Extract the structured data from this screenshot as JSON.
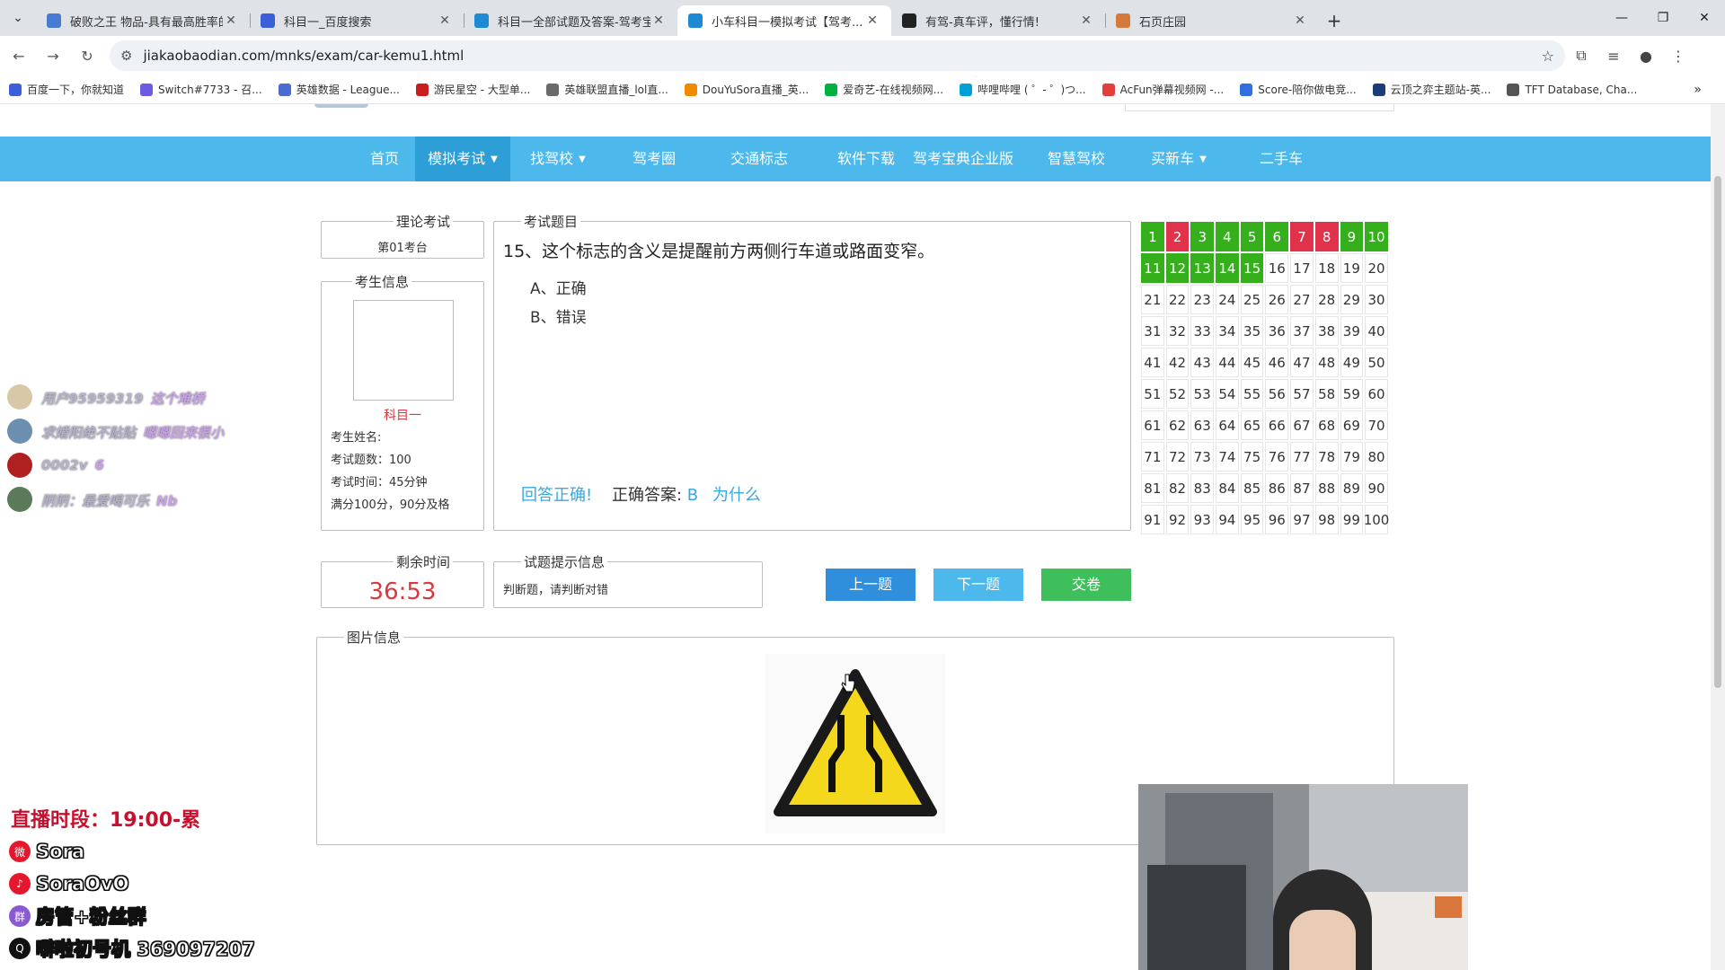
{
  "browser": {
    "tabs": [
      {
        "title": "破败之王 物品-具有最高胜率的...",
        "color": "#4a7bd4",
        "active": false
      },
      {
        "title": "科目一_百度搜索",
        "color": "#3b5fd9",
        "active": false
      },
      {
        "title": "科目一全部试题及答案-驾考宝...",
        "color": "#1f8ad4",
        "active": false
      },
      {
        "title": "小车科目一模拟考试【驾考...",
        "color": "#1f8ad4",
        "active": true
      },
      {
        "title": "有驾-真车评，懂行情!",
        "color": "#222222",
        "active": false
      },
      {
        "title": "石页庄园",
        "color": "#d47a3a",
        "active": false
      }
    ],
    "new_tab": "+",
    "url": "jiakaobaodian.com/mnks/exam/car-kemu1.html",
    "bookmarks": [
      {
        "label": "百度一下，你就知道",
        "color": "#3b5fd9"
      },
      {
        "label": "Switch#7733 - 召...",
        "color": "#6b5be0"
      },
      {
        "label": "英雄数据 - League...",
        "color": "#4a6bd0"
      },
      {
        "label": "游民星空 - 大型单...",
        "color": "#c81e1e"
      },
      {
        "label": "英雄联盟直播_lol直...",
        "color": "#6a6a6a"
      },
      {
        "label": "DouYuSora直播_英...",
        "color": "#f08a00"
      },
      {
        "label": "爱奇艺-在线视频网...",
        "color": "#00b140"
      },
      {
        "label": "哔哩哔哩 ( ゜- ゜)つ...",
        "color": "#00a1d6"
      },
      {
        "label": "AcFun弹幕视频网 -...",
        "color": "#e23e3e"
      },
      {
        "label": "Score-陪你做电竞...",
        "color": "#2f6fe0"
      },
      {
        "label": "云顶之弈主题站-英...",
        "color": "#1a3d7a"
      },
      {
        "label": "TFT Database, Cha...",
        "color": "#555555"
      }
    ]
  },
  "nav": {
    "items": [
      {
        "label": "首页",
        "caret": false,
        "active": false
      },
      {
        "label": "模拟考试",
        "caret": true,
        "active": true
      },
      {
        "label": "找驾校",
        "caret": true,
        "active": false
      },
      {
        "label": "驾考圈",
        "caret": false,
        "active": false
      },
      {
        "label": "交通标志",
        "caret": false,
        "active": false
      },
      {
        "label": "软件下载",
        "caret": false,
        "active": false
      },
      {
        "label": "驾考宝典企业版",
        "caret": false,
        "active": false
      },
      {
        "label": "智慧驾校",
        "caret": false,
        "active": false
      },
      {
        "label": "买新车",
        "caret": true,
        "active": false
      },
      {
        "label": "二手车",
        "caret": false,
        "active": false
      }
    ]
  },
  "exam": {
    "theory_legend": "理论考试",
    "exam_room": "第01考台",
    "student_legend": "考生信息",
    "subject": "科目一",
    "student_name": "考生姓名:",
    "question_count": "考试题数：100",
    "exam_time": "考试时间：45分钟",
    "passing": "满分100分，90分及格",
    "question_legend": "考试题目",
    "question": "15、这个标志的含义是提醒前方两侧行车道或路面变窄。",
    "options": [
      "A、正确",
      "B、错误"
    ],
    "result": "回答正确!",
    "correct_label": "正确答案:",
    "correct_value": "B",
    "why": "为什么",
    "time_legend": "剩余时间",
    "time_left": "36:53",
    "hint_legend": "试题提示信息",
    "hint": "判断题，请判断对错",
    "prev": "上一题",
    "next": "下一题",
    "submit": "交卷",
    "image_legend": "图片信息"
  },
  "answer_grid": {
    "total": 100,
    "correct": [
      1,
      3,
      4,
      5,
      6,
      9,
      10,
      11,
      12,
      13,
      14,
      15
    ],
    "wrong": [
      2,
      7,
      8
    ],
    "correct_color": "#35b01c",
    "wrong_color": "#e0334b"
  },
  "overlay": {
    "chat": [
      {
        "user": "用户95959319",
        "msg": "这个难桥",
        "color": "#d8c8a8"
      },
      {
        "user": "求婚阳绝不贴贴",
        "msg": "嗯嗯回来很小",
        "color": "#6c8fb0"
      },
      {
        "user": "0002v",
        "msg": "6",
        "color": "#b02020"
      },
      {
        "user": "阴阴：最爱喝可乐",
        "msg": "Nb",
        "color": "#5a7a5a"
      }
    ],
    "schedule": "直播时段：19:00-累",
    "socials": [
      {
        "icon": "weibo-icon",
        "text": "Sora",
        "color": "#e6162d"
      },
      {
        "icon": "douyin-icon",
        "text": "SoraOvO",
        "color": "#e6162d"
      },
      {
        "icon": "fan-group-icon",
        "text": "房管+粉丝群",
        "color": "#8a5ad0"
      },
      {
        "icon": "qq-icon",
        "text": "噼啦初号机 369097207",
        "color": "#111111"
      }
    ]
  }
}
